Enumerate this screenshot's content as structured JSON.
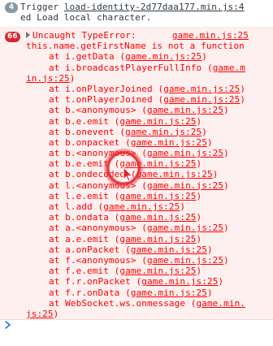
{
  "info_message": {
    "count": "4",
    "prefix": "Trigger ",
    "link": "load-identity-2d77daa177.min.js:4",
    "continuation": "ed Load local character."
  },
  "error_message": {
    "count": "66",
    "title": "Uncaught TypeError:",
    "source": "game.min.js:25",
    "detail": "this.name.getFirstName is not a function",
    "frames": [
      {
        "at": "at i.getData (",
        "link": "game.min.js:25",
        "close": ")"
      },
      {
        "at": "at i.broadcastPlayerFullInfo (",
        "link": "game.m",
        "close": ""
      },
      {
        "at": "",
        "link": "in.js:25",
        "close": ")"
      },
      {
        "at": "at i.onPlayerJoined (",
        "link": "game.min.js:25",
        "close": ")"
      },
      {
        "at": "at t.onPlayerJoined (",
        "link": "game.min.js:25",
        "close": ")"
      },
      {
        "at": "at b.<anonymous> (",
        "link": "game.min.js:25",
        "close": ")"
      },
      {
        "at": "at b.e.emit (",
        "link": "game.min.js:25",
        "close": ")"
      },
      {
        "at": "at b.onevent (",
        "link": "game.min.js:25",
        "close": ")"
      },
      {
        "at": "at b.onpacket (",
        "link": "game.min.js:25",
        "close": ")"
      },
      {
        "at": "at b.<anonymous> (",
        "link": "game.min.js:25",
        "close": ")"
      },
      {
        "at": "at b.e.emit (",
        "link": "game.min.js:25",
        "close": ")"
      },
      {
        "at": "at b.ondecoded (",
        "link": "game.min.js:25",
        "close": ")"
      },
      {
        "at": "at l.<anonymous> (",
        "link": "game.min.js:25",
        "close": ")"
      },
      {
        "at": "at l.e.emit (",
        "link": "game.min.js:25",
        "close": ")"
      },
      {
        "at": "at l.add (",
        "link": "game.min.js:25",
        "close": ")"
      },
      {
        "at": "at b.ondata (",
        "link": "game.min.js:25",
        "close": ")"
      },
      {
        "at": "at a.<anonymous> (",
        "link": "game.min.js:25",
        "close": ")"
      },
      {
        "at": "at a.e.emit (",
        "link": "game.min.js:25",
        "close": ")"
      },
      {
        "at": "at a.onPacket (",
        "link": "game.min.js:25",
        "close": ")"
      },
      {
        "at": "at f.<anonymous> (",
        "link": "game.min.js:25",
        "close": ")"
      },
      {
        "at": "at f.e.emit (",
        "link": "game.min.js:25",
        "close": ")"
      },
      {
        "at": "at f.r.onPacket (",
        "link": "game.min.js:25",
        "close": ")"
      },
      {
        "at": "at f.r.onData (",
        "link": "game.min.js:25",
        "close": ")"
      },
      {
        "at": "at WebSocket.ws.onmessage (",
        "link": "game.min.",
        "close": ""
      },
      {
        "at": "",
        "link": "js:25",
        "close": ")"
      }
    ]
  },
  "prompt_symbol": "›",
  "colors": {
    "error_text": "#ff0000",
    "error_background": "#fff0f0",
    "error_badge": "#d9262e",
    "info_badge": "#8a96a3",
    "prompt": "#1a73e8",
    "cursor_ring": "#e0242c"
  },
  "icons": {
    "expand": "disclosure-triangle-icon",
    "prompt": "console-prompt-icon",
    "cursor": "mouse-pointer-icon"
  }
}
